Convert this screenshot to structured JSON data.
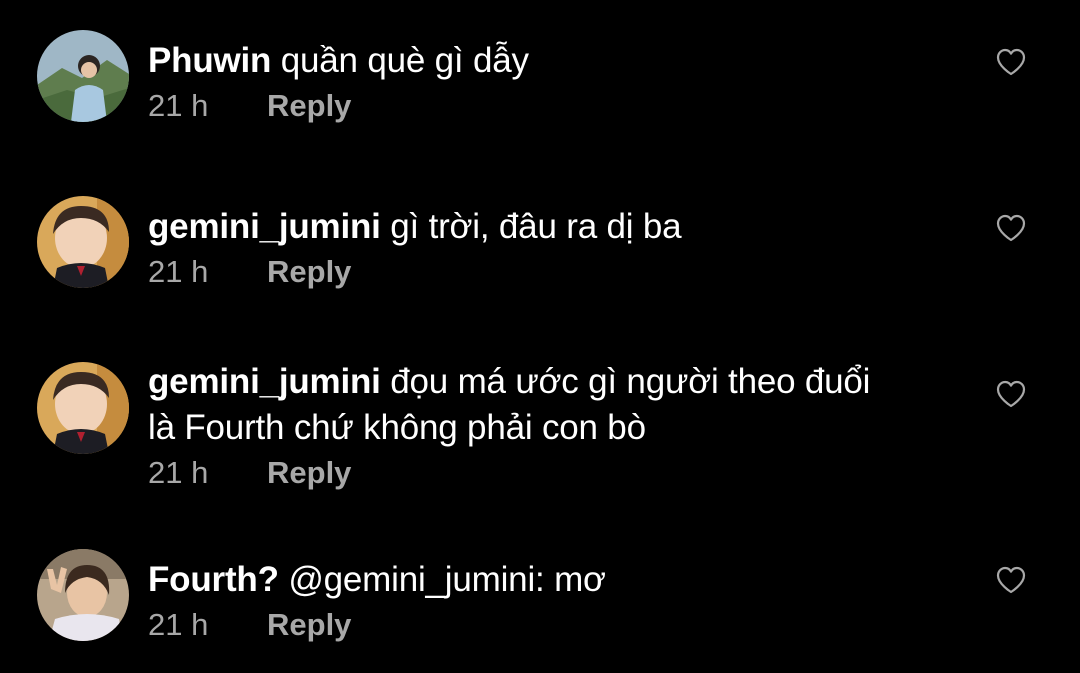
{
  "comments": [
    {
      "username": "Phuwin",
      "text": "quần què gì dẫy",
      "time": "21 h",
      "reply_label": "Reply",
      "avatar_icon": "avatar-photo-mountain"
    },
    {
      "username": "gemini_jumini",
      "text": "gì trời, đâu ra dị ba",
      "time": "21 h",
      "reply_label": "Reply",
      "avatar_icon": "avatar-photo-child"
    },
    {
      "username": "gemini_jumini",
      "text": "đọu má ước gì người theo đuổi là Fourth chứ không phải con bò",
      "time": "21 h",
      "reply_label": "Reply",
      "avatar_icon": "avatar-photo-child"
    },
    {
      "username": "Fourth?",
      "text": "@gemini_jumini: mơ",
      "time": "21 h",
      "reply_label": "Reply",
      "avatar_icon": "avatar-photo-peace-sign"
    }
  ],
  "icons": {
    "like": "heart-outline-icon"
  },
  "colors": {
    "background": "#000000",
    "text": "#ffffff",
    "meta": "#a8a8a8",
    "heart": "#a8a8a8"
  }
}
